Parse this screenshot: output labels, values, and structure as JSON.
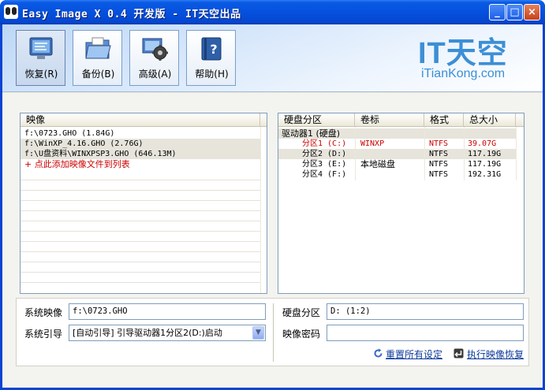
{
  "window": {
    "title": "Easy Image X 0.4 开发版 - IT天空出品",
    "controls": {
      "minimize": "_",
      "maximize": "□",
      "close": "×"
    }
  },
  "toolbar": {
    "buttons": [
      {
        "label": "恢复(R)",
        "icon": "restore-monitor-icon",
        "active": true
      },
      {
        "label": "备份(B)",
        "icon": "backup-folder-icon",
        "active": false
      },
      {
        "label": "高级(A)",
        "icon": "advanced-gear-icon",
        "active": false
      },
      {
        "label": "帮助(H)",
        "icon": "help-book-icon",
        "active": false
      }
    ]
  },
  "logo": {
    "main": "IT天空",
    "sub": "iTianKong.com"
  },
  "images_list": {
    "header": "映像",
    "rows": [
      {
        "text": "f:\\0723.GHO (1.84G)"
      },
      {
        "text": "f:\\WinXP_4.16.GHO (2.76G)"
      },
      {
        "text": "f:\\U盘资料\\WINXPSP3.GHO (646.13M)"
      },
      {
        "text": "+ 点此添加映像文件到列表"
      }
    ]
  },
  "partitions": {
    "columns": [
      "硬盘分区",
      "卷标",
      "格式",
      "总大小"
    ],
    "drive": "驱动器1 (硬盘)",
    "rows": [
      {
        "name": "分区1 (C:)",
        "label": "WINXP",
        "fs": "NTFS",
        "size": "39.07G"
      },
      {
        "name": "分区2 (D:)",
        "label": "",
        "fs": "NTFS",
        "size": "117.19G"
      },
      {
        "name": "分区3 (E:)",
        "label": "本地磁盘",
        "fs": "NTFS",
        "size": "117.19G"
      },
      {
        "name": "分区4 (F:)",
        "label": "",
        "fs": "NTFS",
        "size": "192.31G"
      }
    ]
  },
  "form": {
    "system_image_label": "系统映像",
    "system_image_value": "f:\\0723.GHO",
    "boot_label": "系统引导",
    "boot_value": "[自动引导] 引导驱动器1分区2(D:)启动",
    "partition_label": "硬盘分区",
    "partition_value": "D: (1:2)",
    "password_label": "映像密码",
    "password_value": "",
    "reset_link": "重置所有设定",
    "execute_link": "执行映像恢复"
  },
  "colors": {
    "titlebar": "#0551de",
    "accent_red": "#cc0000",
    "link": "#0b3a9b",
    "logo": "#3c8fd6"
  }
}
